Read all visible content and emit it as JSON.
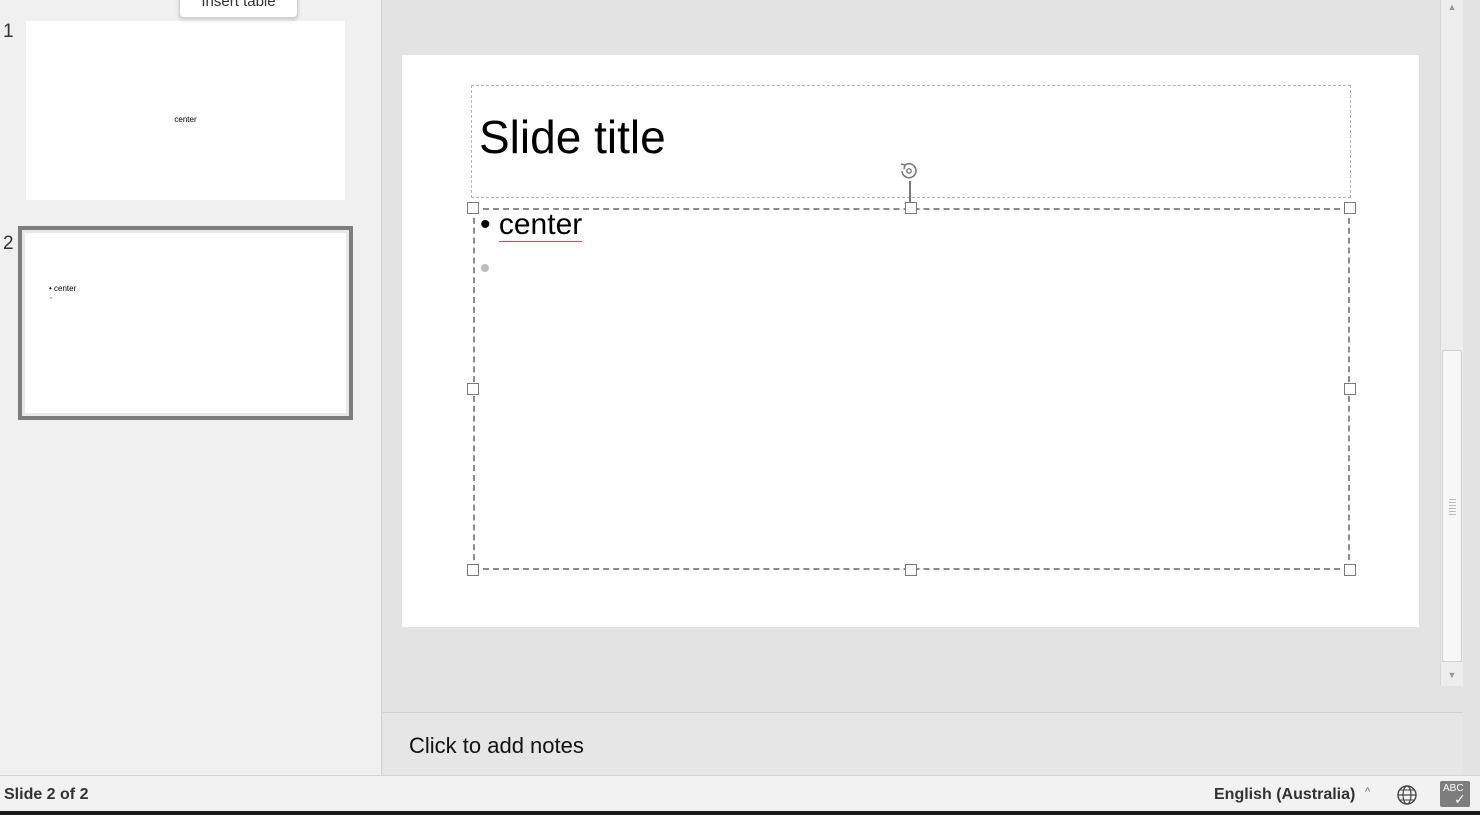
{
  "sorter": {
    "slides": [
      {
        "number": "1",
        "thumb_text": "center"
      },
      {
        "number": "2",
        "thumb_text": "• center"
      }
    ],
    "tooltip": "Insert table"
  },
  "slide": {
    "title": "Slide title",
    "bullet_char": "•",
    "bullet_text": "center"
  },
  "notes": {
    "placeholder": "Click to add notes"
  },
  "status": {
    "slide_position": "Slide 2 of 2",
    "language": "English (Australia)",
    "language_caret": "^",
    "spell_label": "ABC"
  },
  "icons": {
    "rotate": "rotate-handle-icon",
    "globe": "globe-icon",
    "spellcheck": "spellcheck-icon",
    "scroll_up": "scroll-up-arrow",
    "scroll_down": "scroll-down-arrow"
  },
  "colors": {
    "selected_thumb_border": "#7d7d7d",
    "spell_underline": "#e2474f",
    "panel_bg": "#f0f0f0",
    "workspace_bg": "#e3e3e3"
  }
}
